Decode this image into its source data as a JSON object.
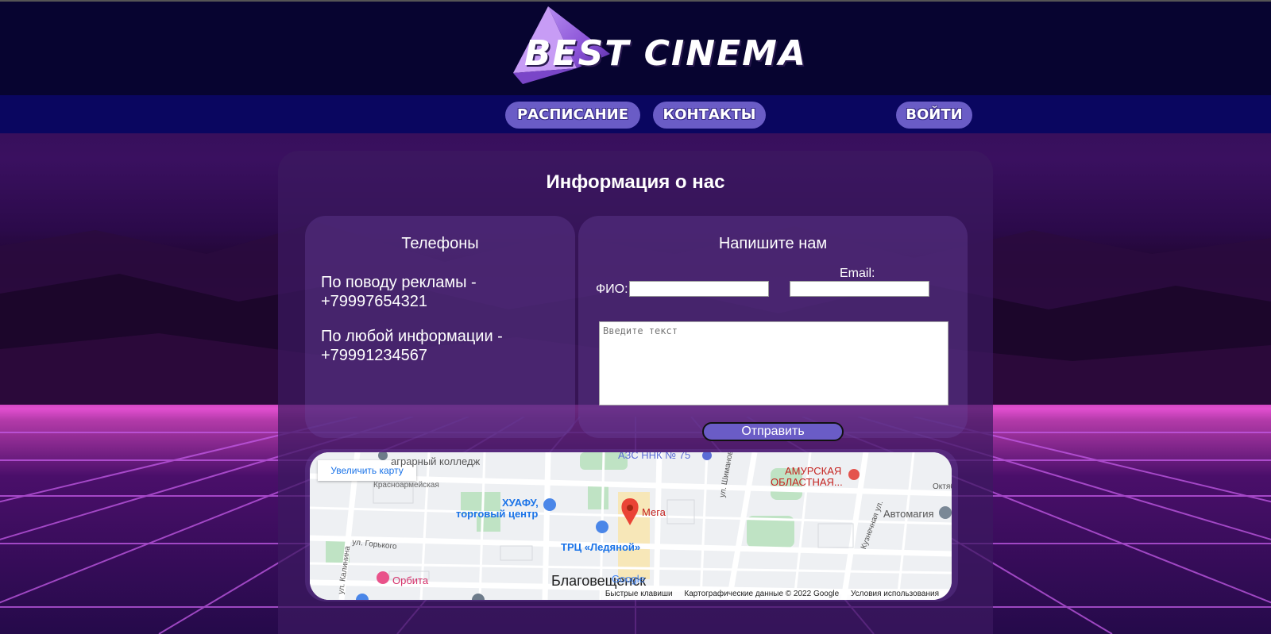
{
  "header": {
    "logo_text": "BEST CINEMA"
  },
  "nav": {
    "schedule": "РАСПИСАНИЕ",
    "contacts": "КОНТАКТЫ",
    "login": "ВОЙТИ"
  },
  "main": {
    "title": "Информация о нас",
    "phones": {
      "title": "Телефоны",
      "ads_label": "По поводу рекламы -",
      "ads_phone": "+79997654321",
      "info_label": "По любой информации -",
      "info_phone": "+79991234567"
    },
    "contact_form": {
      "title": "Напишите нам",
      "name_label": "ФИО:",
      "name_value": "",
      "email_label": "Email:",
      "email_value": "",
      "message_placeholder": "Введите текст",
      "submit_label": "Отправить"
    }
  },
  "map": {
    "enlarge_label": "Увеличить карту",
    "labels": {
      "college": "аграрный колледж",
      "street_krasnoarm": "Красноармейская",
      "azs": "АЗС ННК № 75",
      "amurskaya": "АМУРСКАЯ",
      "oblastnaya": "ОБЛАСТНАЯ...",
      "october": "Октябр",
      "hufu": "ХУАФУ,",
      "trade_center": "торговый центр",
      "mega": "Мега",
      "shimanovskogo": "ул. Шимановского",
      "avtomagiya": "Автомагия",
      "gorkogo": "ул. Горького",
      "ledyanoy": "ТРЦ «Ледяной»",
      "kalinina": "ул. Калинина",
      "kuznechnaya": "Кузнечная ул.",
      "orbita": "Орбита",
      "city": "Благовещенск",
      "google": "Google"
    },
    "footer": {
      "shortcuts": "Быстрые клавиши",
      "data": "Картографические данные © 2022 Google",
      "terms": "Условия использования"
    }
  },
  "colors": {
    "topbar": "#070430",
    "navbar": "#0a0660",
    "button": "#6a5cc6"
  }
}
